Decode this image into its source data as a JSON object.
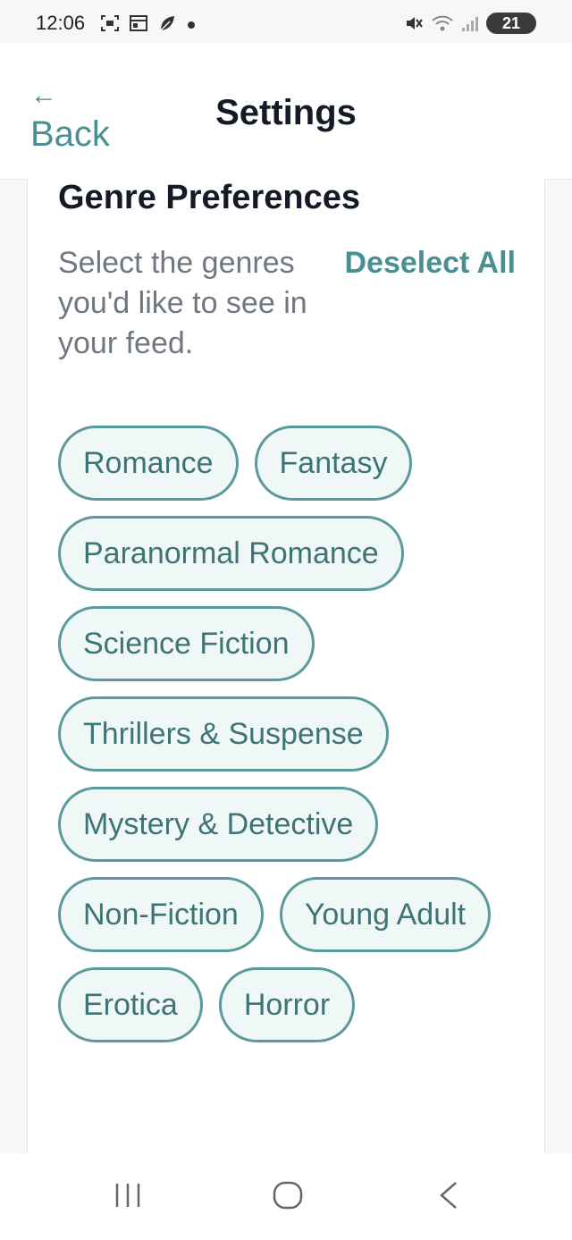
{
  "status_bar": {
    "time": "12:06",
    "battery": "21"
  },
  "header": {
    "back_arrow": "←",
    "back_label": "Back",
    "title": "Settings"
  },
  "genre_section": {
    "title": "Genre Preferences",
    "description": "Select the genres you'd like to see in your feed.",
    "deselect_all": "Deselect All",
    "chips": [
      "Romance",
      "Fantasy",
      "Paranormal Romance",
      "Science Fiction",
      "Thrillers & Suspense",
      "Mystery & Detective",
      "Non-Fiction",
      "Young Adult",
      "Erotica",
      "Horror"
    ]
  },
  "colors": {
    "accent": "#4a8f91",
    "chip_bg": "#eff7f7",
    "chip_border": "#5a9a9c"
  }
}
